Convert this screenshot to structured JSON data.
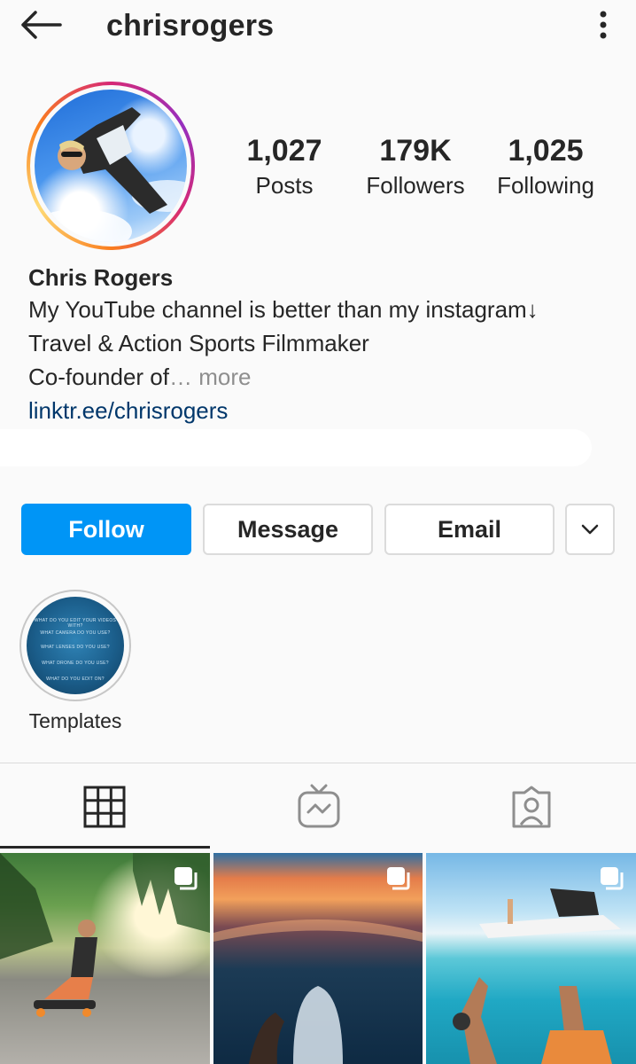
{
  "header": {
    "username": "chrisrogers"
  },
  "stats": [
    {
      "value": "1,027",
      "label": "Posts"
    },
    {
      "value": "179K",
      "label": "Followers"
    },
    {
      "value": "1,025",
      "label": "Following"
    }
  ],
  "bio": {
    "name": "Chris Rogers",
    "line1": "My YouTube channel is better than my instagram↓",
    "line2": "Travel & Action Sports Filmmaker",
    "line3": "Co-founder of",
    "more": "… more",
    "link": "linktr.ee/chrisrogers"
  },
  "actions": {
    "follow": "Follow",
    "message": "Message",
    "email": "Email"
  },
  "highlights": [
    {
      "label": "Templates",
      "lines": [
        "WHAT DO YOU EDIT YOUR VIDEOS WITH?",
        "WHAT CAMERA DO YOU USE?",
        "WHAT LENSES DO YOU USE?",
        "WHAT DRONE DO YOU USE?",
        "WHAT DO YOU EDIT ON?"
      ]
    }
  ],
  "colors": {
    "accent": "#0095f6",
    "link": "#00376b",
    "text": "#262626",
    "muted": "#8e8e8e",
    "background": "#fafafa"
  },
  "icons": {
    "back": "arrow-left-icon",
    "menu": "kebab-menu-icon",
    "more_actions": "chevron-down-icon",
    "grid_tab": "grid-icon",
    "igtv_tab": "igtv-icon",
    "tagged_tab": "tagged-person-icon",
    "multi_post": "carousel-icon"
  }
}
